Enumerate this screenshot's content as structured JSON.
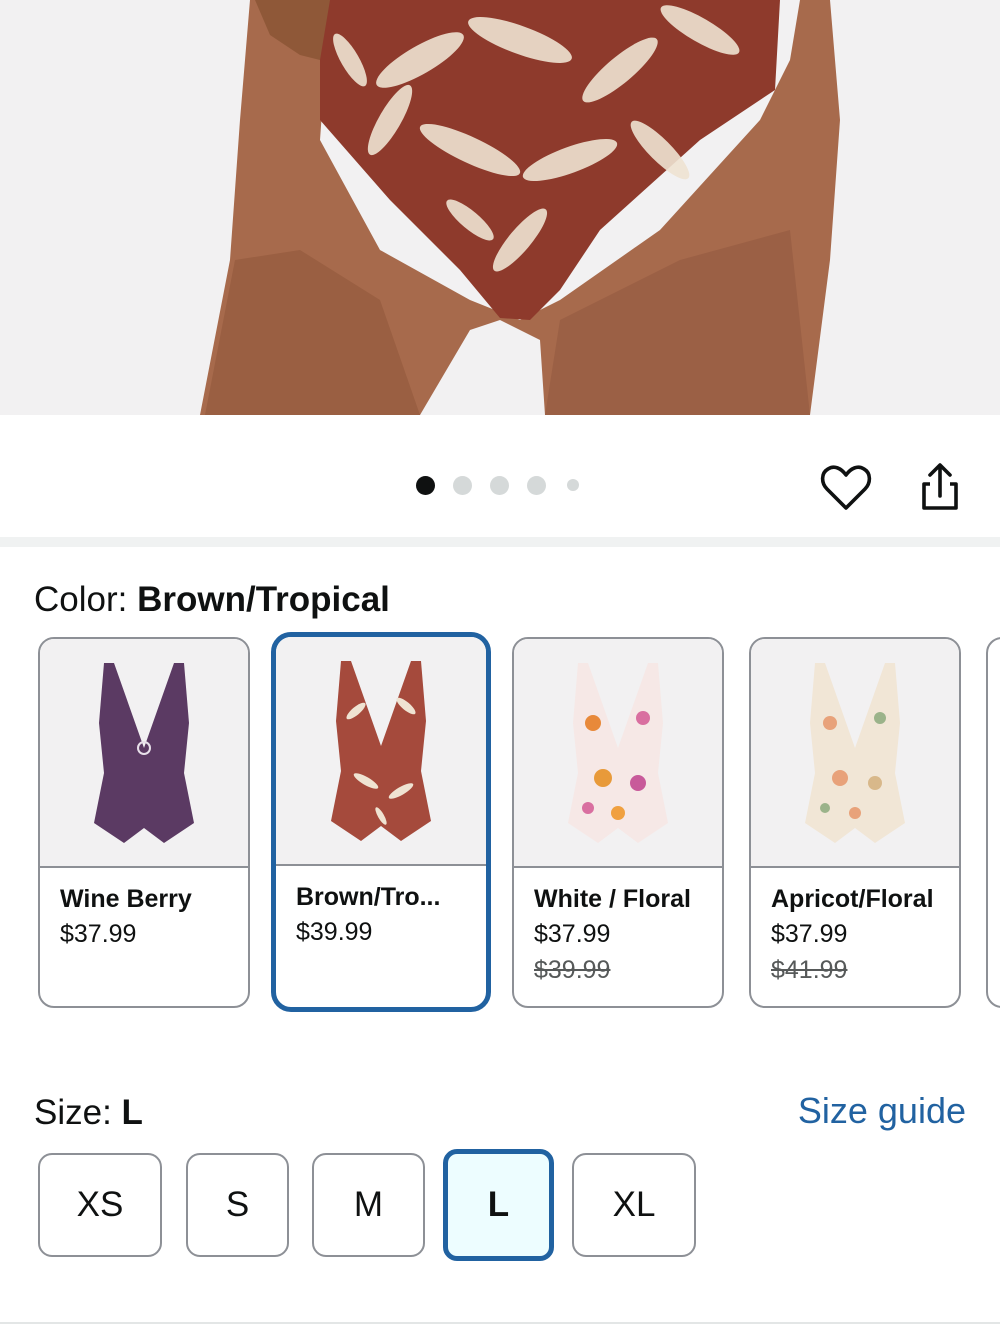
{
  "gallery": {
    "dots": 5,
    "active_dot": 0,
    "icons": {
      "wishlist": "heart-icon",
      "share": "share-icon"
    }
  },
  "color": {
    "label": "Color: ",
    "selected_name": "Brown/Tropical",
    "swatches": [
      {
        "name": "Wine Berry",
        "price": "$37.99",
        "list_price": "",
        "image_color": "#5b3a63"
      },
      {
        "name": "Brown/Tro...",
        "price": "$39.99",
        "list_price": "",
        "image_color": "#a54a3c"
      },
      {
        "name": "White / Floral",
        "price": "$37.99",
        "list_price": "$39.99",
        "image_color": "#e89a6a"
      },
      {
        "name": "Apricot/Floral",
        "price": "$37.99",
        "list_price": "$41.99",
        "image_color": "#e9b99a"
      }
    ]
  },
  "size": {
    "label": "Size: ",
    "selected": "L",
    "guide_label": "Size guide",
    "options": [
      "XS",
      "S",
      "M",
      "L",
      "XL"
    ]
  },
  "colors": {
    "accent": "#2162a1",
    "border": "#8d9096",
    "selected_bg": "#edfdff"
  }
}
